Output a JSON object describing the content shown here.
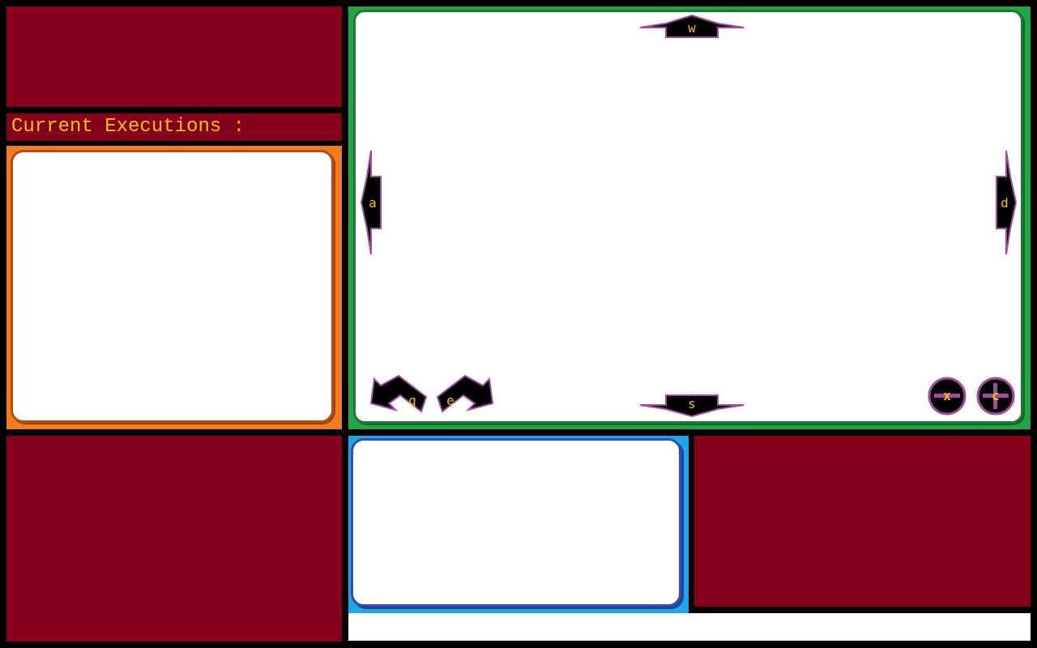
{
  "execution_panel": {
    "header": "Current Executions :",
    "entries": []
  },
  "controls": {
    "up_key": "w",
    "down_key": "s",
    "left_key": "a",
    "right_key": "d",
    "rotate_left_key": "q",
    "rotate_right_key": "e",
    "zoom_out_key": "x",
    "zoom_in_key": "c"
  },
  "colors": {
    "background": "#000000",
    "maroon_panel": "#85001a",
    "header_text": "#f4c20d",
    "execution_panel_border": "#f47c20",
    "viewport_border": "#22a447",
    "console_border": "#1fa6e8",
    "control_fill": "#000000",
    "control_outline": "#a04aa0",
    "control_label": "#f4c20d"
  }
}
